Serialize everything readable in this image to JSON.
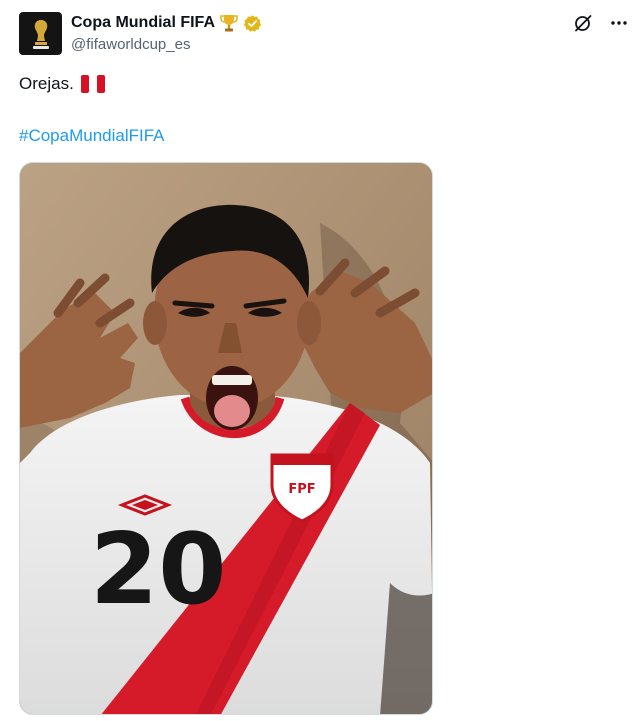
{
  "post": {
    "author": {
      "name": "Copa Mundial FIFA",
      "handle": "@fifaworldcup_es",
      "avatar_icon": "fifa-world-cup-logo-icon",
      "name_emoji_icon": "trophy-icon",
      "verified_icon": "gold-verified-badge-icon"
    },
    "actions": {
      "grok_icon": "grok-icon",
      "more_icon": "more-options-icon"
    },
    "text": "Orejas.",
    "flag_icon": "peru-flag-icon",
    "hashtag": "#CopaMundialFIFA",
    "media": {
      "alt_description": "photo",
      "jersey": {
        "number": "20",
        "crest_letters": "FPF"
      }
    }
  },
  "colors": {
    "link": "#1d9bf0",
    "text": "#0f1419",
    "secondary_text": "#536471",
    "peru_red": "#d91023",
    "verified_gold": "#e2b719"
  }
}
